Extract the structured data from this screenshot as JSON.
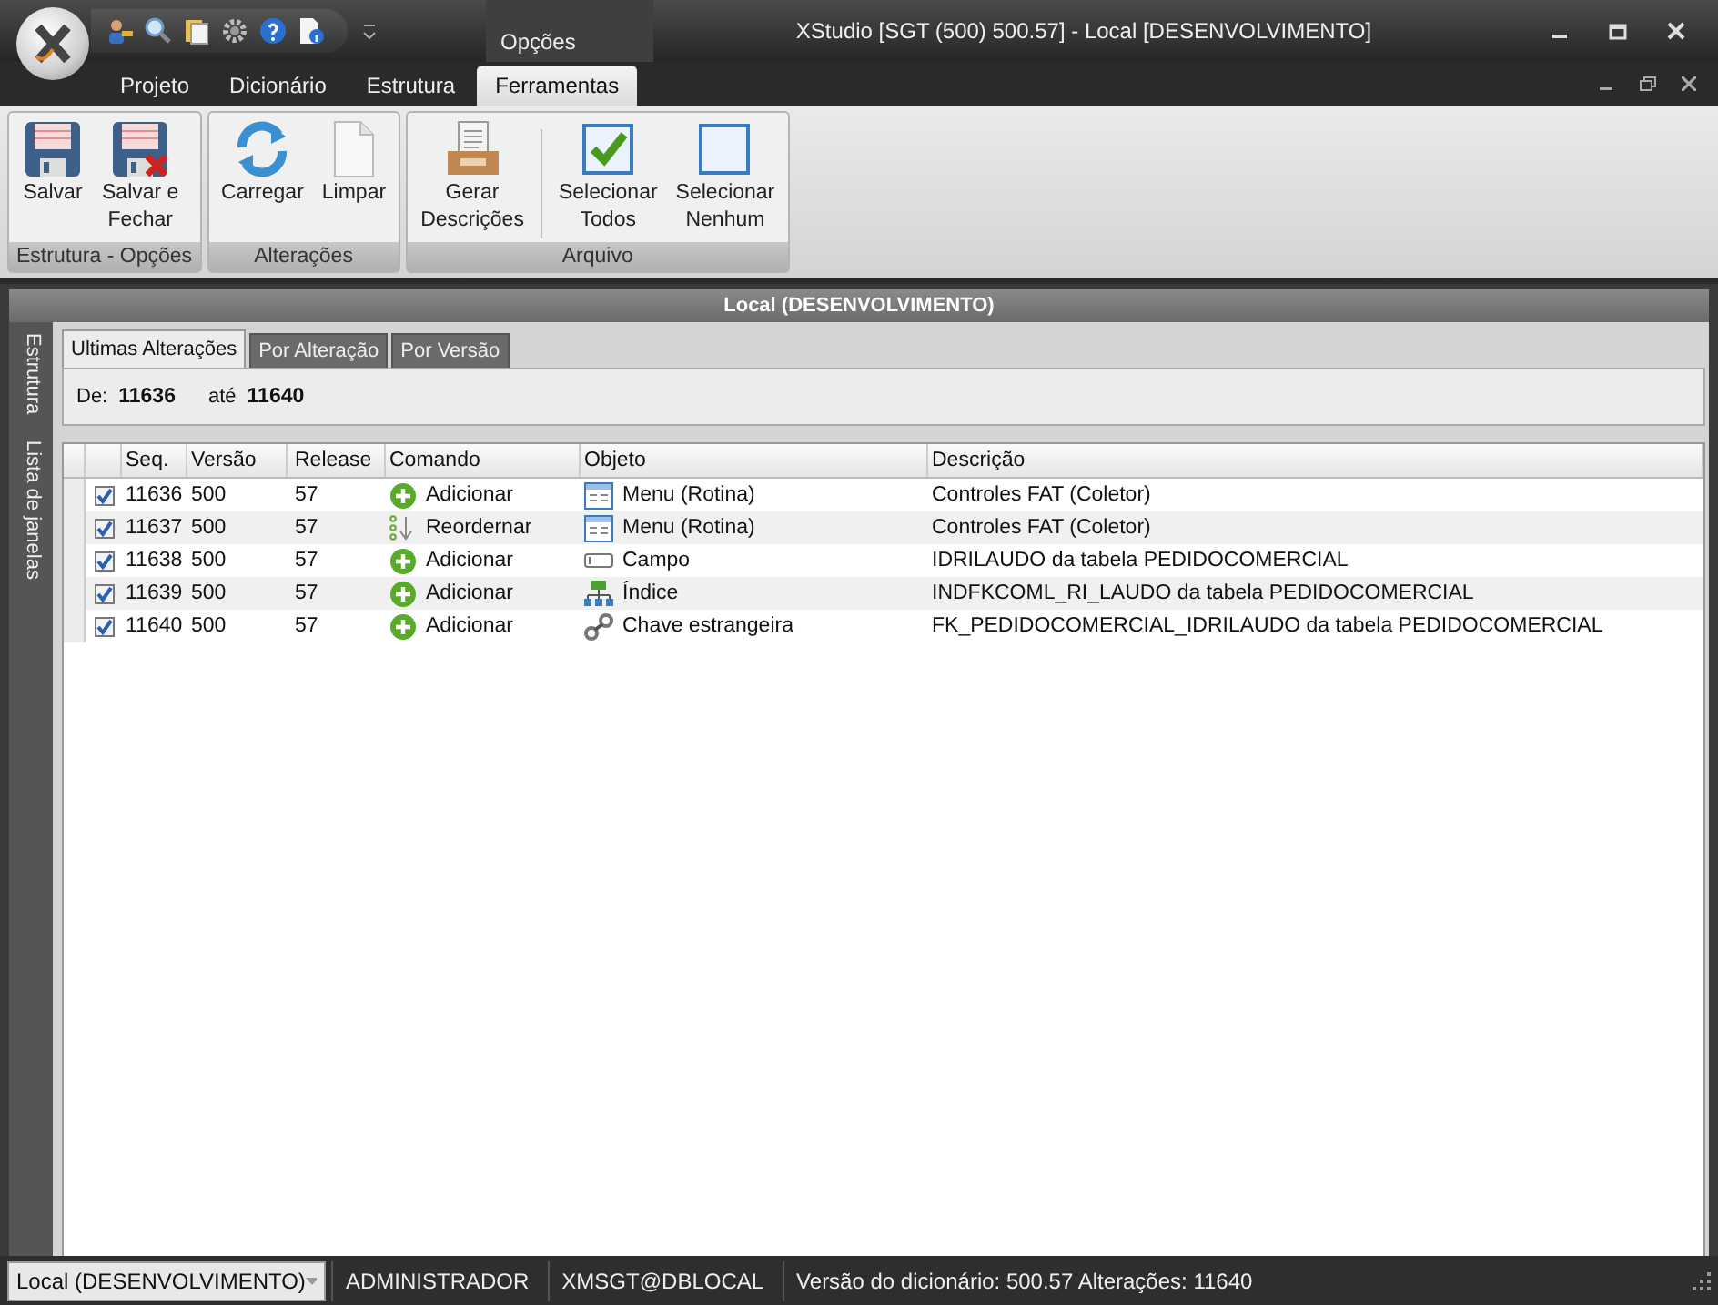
{
  "window": {
    "title": "XStudio [SGT (500) 500.57] - Local [DESENVOLVIMENTO]",
    "contextual_tab": "Opções"
  },
  "quick_access": [
    {
      "kind": "user"
    },
    {
      "kind": "search"
    },
    {
      "kind": "docs"
    },
    {
      "kind": "gear"
    },
    {
      "kind": "help"
    },
    {
      "kind": "info"
    }
  ],
  "ribbon_tabs": [
    {
      "label": "Projeto",
      "selected": false
    },
    {
      "label": "Dicionário",
      "selected": false
    },
    {
      "label": "Estrutura",
      "selected": false
    },
    {
      "label": "Ferramentas",
      "selected": true
    }
  ],
  "ribbon_groups": [
    {
      "title": "Estrutura - Opções",
      "buttons": [
        {
          "label": "Salvar",
          "kind": "save"
        },
        {
          "label": "Salvar e\nFechar",
          "kind": "save-close"
        }
      ]
    },
    {
      "title": "Alterações",
      "buttons": [
        {
          "label": "Carregar",
          "kind": "refresh"
        },
        {
          "label": "Limpar",
          "kind": "page"
        }
      ]
    },
    {
      "title": "Arquivo",
      "buttons": [
        {
          "label": "Gerar\nDescrições",
          "kind": "tray"
        },
        {
          "label": "Selecionar\nTodos",
          "kind": "check-all"
        },
        {
          "label": "Selecionar\nNenhum",
          "kind": "check-none"
        }
      ]
    }
  ],
  "panel_title": "Local (DESENVOLVIMENTO)",
  "side_tabs": [
    "Estrutura",
    "Lista de janelas"
  ],
  "view_tabs": [
    {
      "label": "Ultimas Alterações",
      "selected": true
    },
    {
      "label": "Por Alteração",
      "selected": false
    },
    {
      "label": "Por Versão",
      "selected": false
    }
  ],
  "filter": {
    "from_label": "De:",
    "from": "11636",
    "to_label": "até",
    "to": "11640"
  },
  "table": {
    "columns": [
      "Seq.",
      "Versão",
      "Release",
      "Comando",
      "Objeto",
      "Descrição"
    ],
    "rows": [
      {
        "checked": true,
        "seq": "11636",
        "version": "500",
        "release": "57",
        "command": {
          "kind": "add",
          "label": "Adicionar"
        },
        "object": {
          "kind": "menu",
          "label": "Menu (Rotina)"
        },
        "description": "Controles FAT (Coletor)"
      },
      {
        "checked": true,
        "seq": "11637",
        "version": "500",
        "release": "57",
        "command": {
          "kind": "reorder",
          "label": "Reordernar"
        },
        "object": {
          "kind": "menu",
          "label": "Menu (Rotina)"
        },
        "description": "Controles FAT (Coletor)"
      },
      {
        "checked": true,
        "seq": "11638",
        "version": "500",
        "release": "57",
        "command": {
          "kind": "add",
          "label": "Adicionar"
        },
        "object": {
          "kind": "field",
          "label": "Campo"
        },
        "description": "IDRILAUDO da tabela PEDIDOCOMERCIAL"
      },
      {
        "checked": true,
        "seq": "11639",
        "version": "500",
        "release": "57",
        "command": {
          "kind": "add",
          "label": "Adicionar"
        },
        "object": {
          "kind": "index",
          "label": "Índice"
        },
        "description": "INDFKCOML_RI_LAUDO da tabela PEDIDOCOMERCIAL"
      },
      {
        "checked": true,
        "seq": "11640",
        "version": "500",
        "release": "57",
        "command": {
          "kind": "add",
          "label": "Adicionar"
        },
        "object": {
          "kind": "fk",
          "label": "Chave estrangeira"
        },
        "description": "FK_PEDIDOCOMERCIAL_IDRILAUDO da tabela PEDIDOCOMERCIAL"
      }
    ]
  },
  "status_bar": {
    "connection": "Local (DESENVOLVIMENTO)",
    "user": "ADMINISTRADOR",
    "database": "XMSGT@DBLOCAL",
    "info": "Versão do dicionário: 500.57 Alterações: 11640"
  }
}
